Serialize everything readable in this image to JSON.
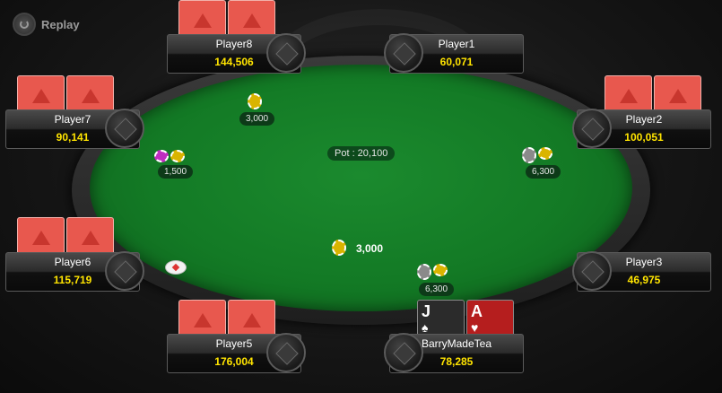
{
  "replay": {
    "label": "Replay"
  },
  "table": {
    "pot_label": "Pot : 20,100",
    "center_pot": "3,000"
  },
  "players": {
    "player8": {
      "name": "Player8",
      "stack": "144,506"
    },
    "player1": {
      "name": "Player1",
      "stack": "60,071"
    },
    "player7": {
      "name": "Player7",
      "stack": "90,141"
    },
    "player2": {
      "name": "Player2",
      "stack": "100,051"
    },
    "player6": {
      "name": "Player6",
      "stack": "115,719"
    },
    "player3": {
      "name": "Player3",
      "stack": "46,975"
    },
    "player5": {
      "name": "Player5",
      "stack": "176,004"
    },
    "hero": {
      "name": "BarryMadeTea",
      "stack": "78,285"
    }
  },
  "bets": {
    "player8": "3,000",
    "player7": "1,500",
    "player2": "6,300",
    "hero": "6,300"
  },
  "hero_cards": [
    {
      "rank": "J",
      "suit": "♠",
      "color": "#2b2b2b"
    },
    {
      "rank": "A",
      "suit": "♥",
      "color": "#b51e1e"
    }
  ],
  "colors": {
    "felt": "#137a25",
    "stack_text": "#ffe400",
    "card_back": "#e8584e"
  }
}
